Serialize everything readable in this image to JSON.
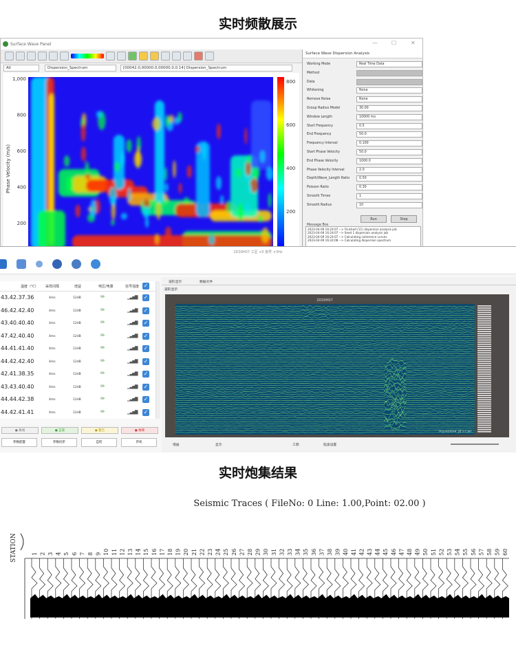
{
  "headings": {
    "top": "实时频散展示",
    "middle": "实时炮集结果"
  },
  "dispersion_window": {
    "title": "Surface Wave Panel",
    "combo_all": "All",
    "combo_view": "Dispersion_Spectrum",
    "combo_info": "[00042.0,00000.0,00000.0,0.14] Dispersion_Spectrum",
    "y_axis_label": "Phase Velocity (m/s)",
    "y_ticks": [
      "1,000",
      "800",
      "600",
      "400",
      "200"
    ],
    "colorbar_ticks": [
      "800",
      "600",
      "400",
      "200"
    ],
    "side_title": "Surface Wave Dispersion Analysis",
    "params": [
      {
        "label": "Working Mode",
        "value": "Real Time Data"
      },
      {
        "label": "Method",
        "value": "",
        "gray": true
      },
      {
        "label": "Data",
        "value": "",
        "gray": true
      },
      {
        "label": "Whitening",
        "value": "None"
      },
      {
        "label": "Remove Noise",
        "value": "None"
      },
      {
        "label": "Group Radius Model",
        "value": "30.00"
      },
      {
        "label": "Window Length",
        "value": "10000 ms"
      },
      {
        "label": "Start Frequency",
        "value": "0.5"
      },
      {
        "label": "End Frequency",
        "value": "50.0"
      },
      {
        "label": "Frequency Interval",
        "value": "0.100"
      },
      {
        "label": "Start Phase Velocity",
        "value": "50.0"
      },
      {
        "label": "End Phase Velocity",
        "value": "1000.0"
      },
      {
        "label": "Phase Velocity Interval",
        "value": "2.0"
      },
      {
        "label": "Depth/Wave_Length Ratio",
        "value": "0.50"
      },
      {
        "label": "Poisson Ratio",
        "value": "0.30"
      },
      {
        "label": "Smooth Times",
        "value": "1"
      },
      {
        "label": "Smooth Radius",
        "value": "10"
      }
    ],
    "btn_run": "Run",
    "btn_stop": "Stop",
    "message_label": "Message Box",
    "messages": [
      "2023-04-09 16:24:07 --> Finished (11) dispersion analysis job",
      "2023-04-09 16:24:07 --> Seed 1 dispersion analysis job",
      "2023-04-09 16:24:07 --> Calculating coherence curves",
      "2023-04-09 16:24:08 --> Calculating dispersion spectrum"
    ]
  },
  "acquisition_window": {
    "title": "2D30H07 工区 ×5 炮号 ×3Hz",
    "header": {
      "col1": "温度（℃）",
      "col2": "采样间隔",
      "col3": "增益",
      "col4": "电压/电量",
      "col5": "信号强度"
    },
    "rows": [
      {
        "temps": "43.42.37.36",
        "interval": "4ms",
        "gain": "12dB",
        "batt": "99"
      },
      {
        "temps": "46.42.42.40",
        "interval": "4ms",
        "gain": "12dB",
        "batt": "99"
      },
      {
        "temps": "43.40.40.40",
        "interval": "4ms",
        "gain": "12dB",
        "batt": "99"
      },
      {
        "temps": "47.42.40.40",
        "interval": "4ms",
        "gain": "12dB",
        "batt": "99"
      },
      {
        "temps": "44.41.41.40",
        "interval": "4ms",
        "gain": "12dB",
        "batt": "99"
      },
      {
        "temps": "44.42.42.40",
        "interval": "4ms",
        "gain": "12dB",
        "batt": "99"
      },
      {
        "temps": "42.41.38.35",
        "interval": "4ms",
        "gain": "12dB",
        "batt": "99"
      },
      {
        "temps": "43.43.40.40",
        "interval": "4ms",
        "gain": "12dB",
        "batt": "99"
      },
      {
        "temps": "44.44.42.38",
        "interval": "4ms",
        "gain": "12dB",
        "batt": "99"
      },
      {
        "temps": "44.42.41.41",
        "interval": "4ms",
        "gain": "12dB",
        "batt": "99"
      }
    ],
    "status_buttons": [
      "● 离线",
      "● 正常",
      "● 警告",
      "● 故障"
    ],
    "action_buttons": [
      "参数配置",
      "参数同步",
      "自检",
      "开机"
    ],
    "tabs": [
      "波形显示",
      "数据文件"
    ],
    "wave_title": "波形显示",
    "wave_header": "2D30H07",
    "wave_footer": "2023/04/09 16:27:40",
    "bottom_labels": [
      "增益",
      "显示",
      "工频",
      "陷波设置"
    ]
  },
  "gather": {
    "title": "Seismic Traces ( FileNo: 0  Line: 1.00,Point: 02.00 )",
    "axis_label": "STATION",
    "station_count": 60
  }
}
